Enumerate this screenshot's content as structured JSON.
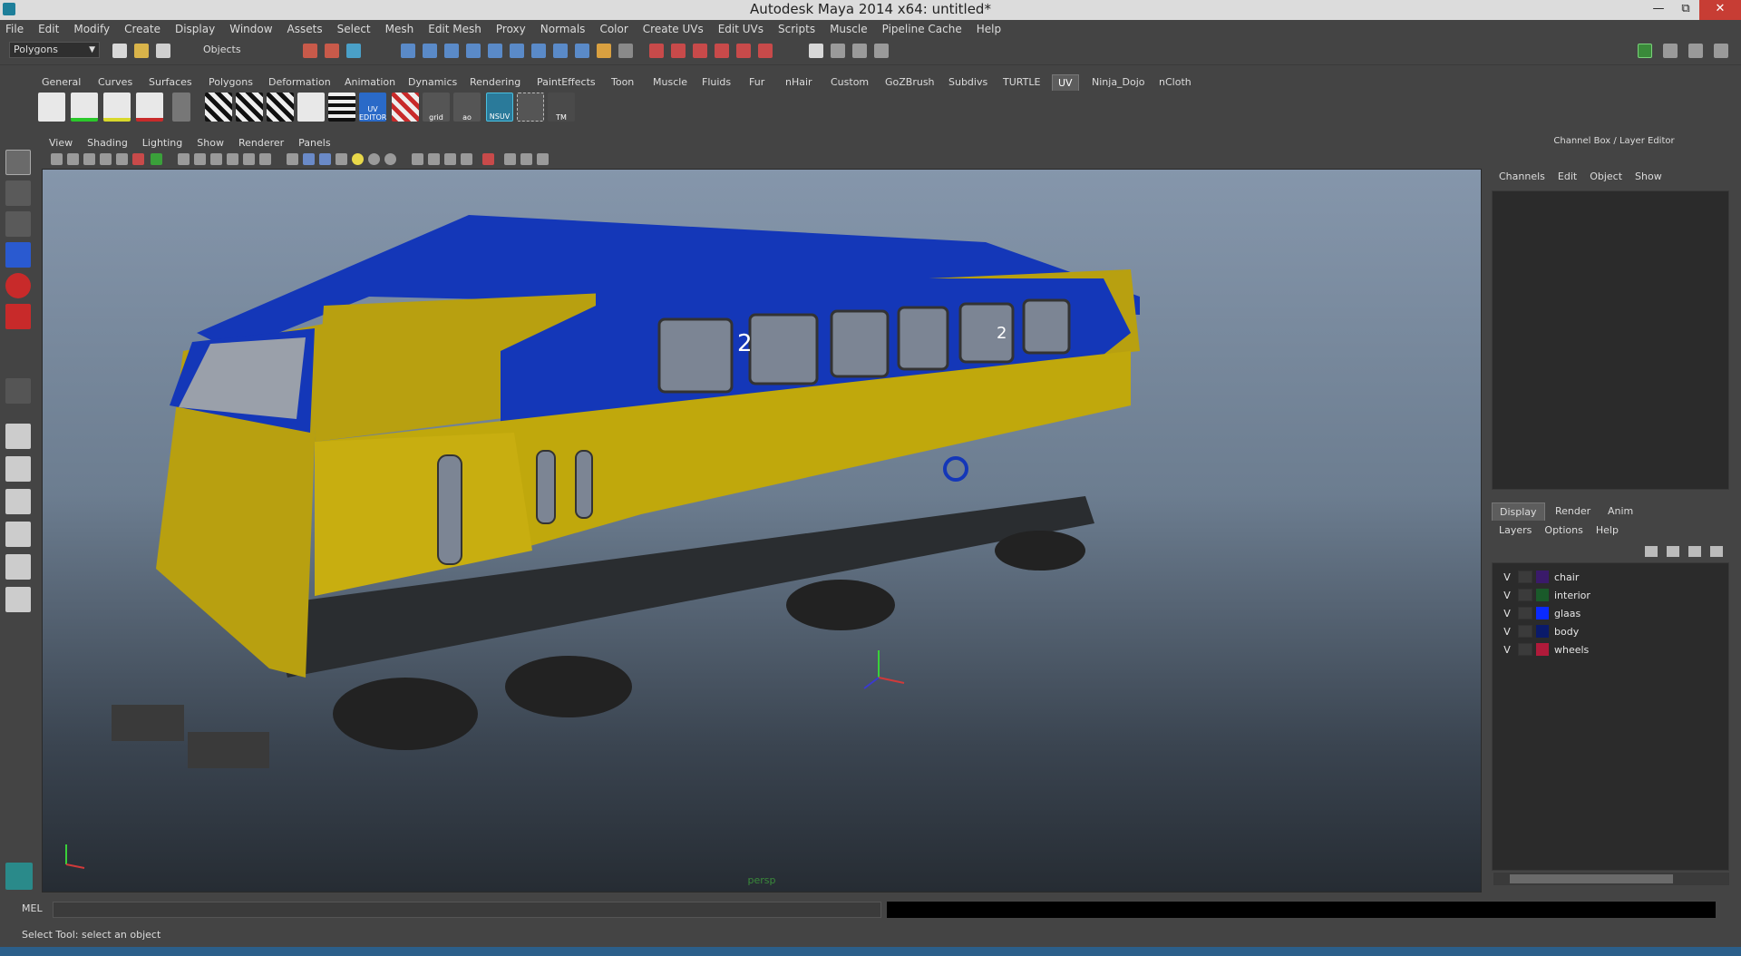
{
  "window": {
    "title": "Autodesk Maya 2014 x64: untitled*"
  },
  "menus": [
    "File",
    "Edit",
    "Modify",
    "Create",
    "Display",
    "Window",
    "Assets",
    "Select",
    "Mesh",
    "Edit Mesh",
    "Proxy",
    "Normals",
    "Color",
    "Create UVs",
    "Edit UVs",
    "Scripts",
    "Muscle",
    "Pipeline Cache",
    "Help"
  ],
  "statusline": {
    "mode": "Polygons",
    "object_field": "Objects"
  },
  "shelf": {
    "tabs": [
      "General",
      "Curves",
      "Surfaces",
      "Polygons",
      "Deformation",
      "Animation",
      "Dynamics",
      "Rendering",
      "PaintEffects",
      "Toon",
      "Muscle",
      "Fluids",
      "Fur",
      "nHair",
      "Custom",
      "GoZBrush",
      "Subdivs",
      "TURTLE",
      "UV",
      "Ninja_Dojo",
      "nCloth"
    ],
    "active_tab": "UV",
    "icon_labels": [
      "UV EDITOR",
      "grid",
      "ao",
      "NSUV",
      "TM"
    ]
  },
  "viewport": {
    "menus": [
      "View",
      "Shading",
      "Lighting",
      "Show",
      "Renderer",
      "Panels"
    ],
    "camera": "persp",
    "car_numbers": [
      "2",
      "2"
    ]
  },
  "channel_box": {
    "title": "Channel Box / Layer Editor",
    "menus": [
      "Channels",
      "Edit",
      "Object",
      "Show"
    ]
  },
  "layer_editor": {
    "tabs": [
      "Display",
      "Render",
      "Anim"
    ],
    "active_tab": "Display",
    "menus": [
      "Layers",
      "Options",
      "Help"
    ],
    "layers": [
      {
        "visible": "V",
        "name": "chair",
        "color": "#3a1a6a"
      },
      {
        "visible": "V",
        "name": "interior",
        "color": "#1a5a2a"
      },
      {
        "visible": "V",
        "name": "glaas",
        "color": "#0a2aff"
      },
      {
        "visible": "V",
        "name": "body",
        "color": "#0a1a6a"
      },
      {
        "visible": "V",
        "name": "wheels",
        "color": "#b01a3a"
      }
    ]
  },
  "command_line": {
    "label": "MEL"
  },
  "help_line": {
    "text": "Select Tool: select an object"
  }
}
